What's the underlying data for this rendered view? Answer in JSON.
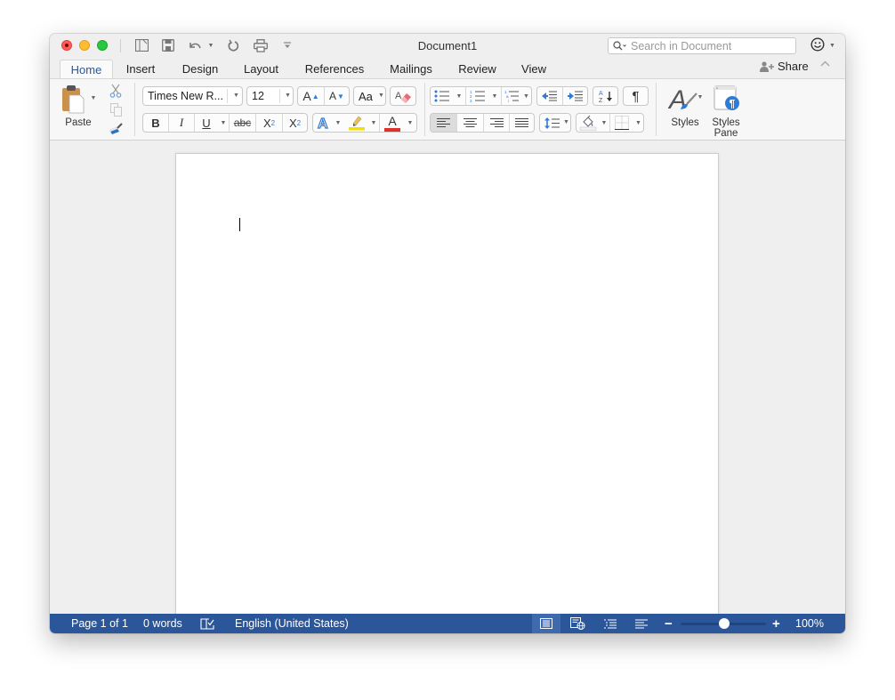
{
  "window": {
    "title": "Document1"
  },
  "quick_access": {
    "items": [
      {
        "name": "sidebar-toggle",
        "icon": "sidebar-icon"
      },
      {
        "name": "save",
        "icon": "save-icon"
      },
      {
        "name": "undo",
        "icon": "undo-icon"
      },
      {
        "name": "redo",
        "icon": "redo-icon"
      },
      {
        "name": "print",
        "icon": "print-icon"
      },
      {
        "name": "customize",
        "icon": "customize-toolbar-icon"
      }
    ]
  },
  "search": {
    "placeholder": "Search in Document",
    "icon": "search-icon"
  },
  "account": {
    "icon": "smiley-feedback-icon"
  },
  "tabs": [
    {
      "label": "Home",
      "active": true
    },
    {
      "label": "Insert",
      "active": false
    },
    {
      "label": "Design",
      "active": false
    },
    {
      "label": "Layout",
      "active": false
    },
    {
      "label": "References",
      "active": false
    },
    {
      "label": "Mailings",
      "active": false
    },
    {
      "label": "Review",
      "active": false
    },
    {
      "label": "View",
      "active": false
    }
  ],
  "share": {
    "label": "Share",
    "icon": "add-person-icon"
  },
  "ribbon": {
    "clipboard": {
      "paste_label": "Paste",
      "cut_icon": "scissors-icon",
      "copy_icon": "copy-icon",
      "format_painter_icon": "paintbrush-icon"
    },
    "font": {
      "font_name": "Times New R...",
      "font_size": "12",
      "grow_font": "A",
      "shrink_font": "A",
      "change_case": "Aa",
      "clear_formatting_icon": "eraser-icon",
      "bold": "B",
      "italic": "I",
      "underline": "U",
      "strikethrough": "abc",
      "subscript": "X",
      "subscript_sub": "2",
      "superscript": "X",
      "superscript_sup": "2",
      "text_effects": "A",
      "highlight_color": "#f5e100",
      "font_color_letter": "A",
      "font_color": "#e0302a"
    },
    "paragraph": {
      "bullets_icon": "bullets-icon",
      "numbering_icon": "numbering-icon",
      "multilevel_icon": "multilevel-list-icon",
      "decrease_indent_icon": "decrease-indent-icon",
      "increase_indent_icon": "increase-indent-icon",
      "sort_icon": "sort-icon",
      "show_marks": "¶",
      "align_left_active": true,
      "line_spacing_icon": "line-spacing-icon",
      "shading_icon": "shading-icon",
      "borders_icon": "borders-icon"
    },
    "styles": {
      "styles_label": "Styles",
      "styles_pane_label_1": "Styles",
      "styles_pane_label_2": "Pane"
    }
  },
  "statusbar": {
    "page": "Page 1 of 1",
    "words": "0 words",
    "proofing_icon": "proofing-book-icon",
    "language": "English (United States)",
    "views": [
      {
        "name": "print-layout",
        "active": true
      },
      {
        "name": "web-layout",
        "active": false
      },
      {
        "name": "outline",
        "active": false
      },
      {
        "name": "draft",
        "active": false
      }
    ],
    "zoom_minus": "−",
    "zoom_plus": "+",
    "zoom_level": "100%",
    "zoom_percent": 100
  },
  "colors": {
    "accent": "#2b579a",
    "statusbar_bg": "#2b579a",
    "ribbon_bg": "#f7f7f7"
  }
}
